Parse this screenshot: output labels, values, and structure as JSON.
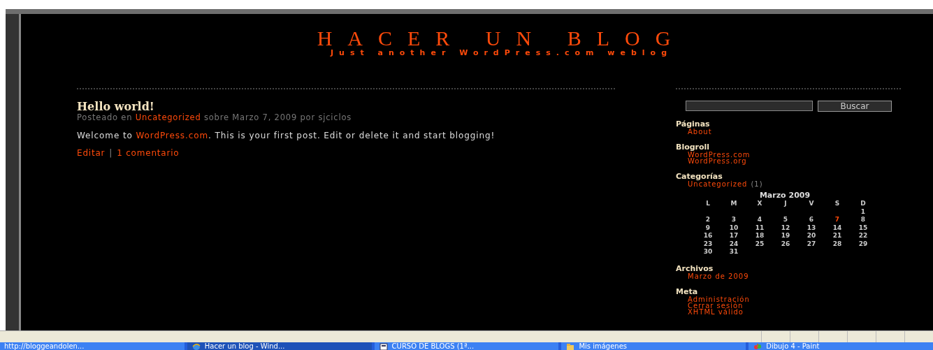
{
  "blog": {
    "title": "HACER UN BLOG",
    "tagline": "Just another WordPress.com weblog"
  },
  "post": {
    "title": "Hello world!",
    "meta": [
      {
        "text": "Posteado en ",
        "link": false
      },
      {
        "text": "Uncategorized",
        "link": true
      },
      {
        "text": " sobre Marzo 7, 2009 por sjciclos",
        "link": false
      }
    ],
    "body": [
      {
        "text": "Welcome to ",
        "link": false
      },
      {
        "text": "WordPress.com",
        "link": true
      },
      {
        "text": ". This is your first post. Edit or delete it and start blogging!",
        "link": false
      }
    ],
    "edit_link": "Editar",
    "separator": "|",
    "comments_link": "1 comentario"
  },
  "search": {
    "button": "Buscar"
  },
  "widgets": [
    {
      "title": "Páginas",
      "links": [
        {
          "text": "About"
        }
      ]
    },
    {
      "title": "Blogroll",
      "links": [
        {
          "text": "WordPress.com"
        },
        {
          "text": "WordPress.org"
        }
      ]
    },
    {
      "title": "Categorías",
      "links": [
        {
          "text": "Uncategorized",
          "count": "(1)"
        }
      ]
    }
  ],
  "calendar": {
    "caption": "Marzo 2009",
    "weekdays": [
      "L",
      "M",
      "X",
      "J",
      "V",
      "S",
      "D"
    ],
    "weeks": [
      [
        {
          "day": "1",
          "link": false
        }
      ],
      [
        {
          "day": "2",
          "link": false
        },
        {
          "day": "3",
          "link": false
        },
        {
          "day": "4",
          "link": false
        },
        {
          "day": "5",
          "link": false
        },
        {
          "day": "6",
          "link": false
        },
        {
          "day": "7",
          "link": true
        },
        {
          "day": "8",
          "link": false
        }
      ],
      [
        {
          "day": "9",
          "link": false
        },
        {
          "day": "10",
          "link": false
        },
        {
          "day": "11",
          "link": false
        },
        {
          "day": "12",
          "link": false
        },
        {
          "day": "13",
          "link": false
        },
        {
          "day": "14",
          "link": false
        },
        {
          "day": "15",
          "link": false
        }
      ],
      [
        {
          "day": "16",
          "link": false
        },
        {
          "day": "17",
          "link": false
        },
        {
          "day": "18",
          "link": false
        },
        {
          "day": "19",
          "link": false
        },
        {
          "day": "20",
          "link": false
        },
        {
          "day": "21",
          "link": false
        },
        {
          "day": "22",
          "link": false
        }
      ],
      [
        {
          "day": "23",
          "link": false
        },
        {
          "day": "24",
          "link": false
        },
        {
          "day": "25",
          "link": false
        },
        {
          "day": "26",
          "link": false
        },
        {
          "day": "27",
          "link": false
        },
        {
          "day": "28",
          "link": false
        },
        {
          "day": "29",
          "link": false
        }
      ],
      [
        {
          "day": "30",
          "link": false
        },
        {
          "day": "31",
          "link": false
        }
      ]
    ]
  },
  "widgets_after": [
    {
      "title": "Archivos",
      "links": [
        {
          "text": "Marzo de 2009"
        }
      ]
    },
    {
      "title": "Meta",
      "links": [
        {
          "text": "Administración"
        },
        {
          "text": "Cerrar sesión"
        },
        {
          "text": "XHTML válido"
        }
      ]
    }
  ],
  "taskbar": [
    {
      "label": "http://bloggeandolen...",
      "kind": "plain",
      "selected": false
    },
    {
      "label": "Hacer un blog - Wind...",
      "kind": "browser",
      "selected": true
    },
    {
      "label": "CURSO DE BLOGS (1ª...",
      "kind": "document",
      "selected": false
    },
    {
      "label": "Mis imágenes",
      "kind": "folder",
      "selected": false
    },
    {
      "label": "Dibujo 4 - Paint",
      "kind": "paint",
      "selected": false
    }
  ]
}
